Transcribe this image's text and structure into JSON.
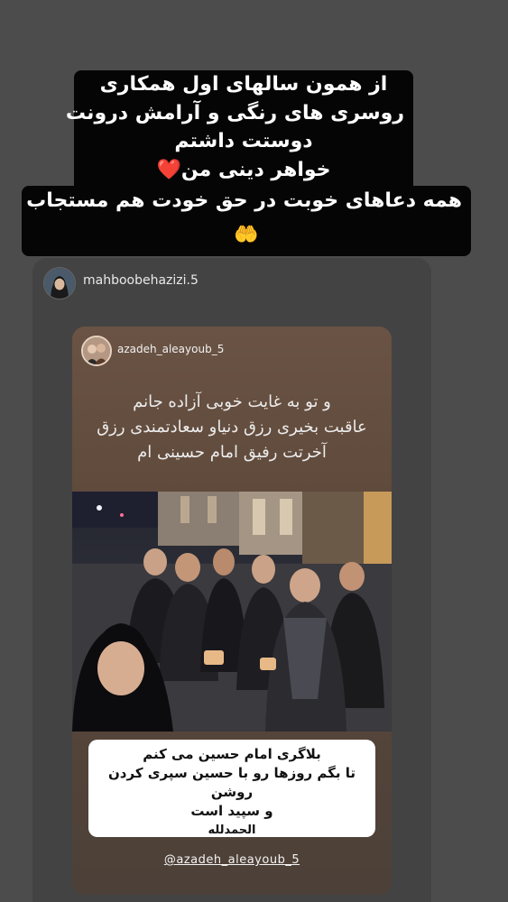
{
  "caption": {
    "lines": [
      "از همون سالهای اول همکاری",
      "روسری های رنگی و آرامش درونت",
      "دوستت داشتم",
      "خواهر دینی من❤️",
      "همه دعاهای خوبت در حق خودت هم مستجاب",
      "🤲"
    ]
  },
  "repost": {
    "username": "mahboobehazizi.5",
    "inner": {
      "username": "azadeh_aleayoub_5",
      "text_lines": [
        "و تو به غایت خوبی آزاده جانم",
        "عاقبت بخیری رزق دنیاو سعادتمندی رزق",
        "آخرتت رفیق امام حسینی ام"
      ],
      "sticker_lines": [
        "بلاگری امام حسین می کنم",
        "تا بگم روزها رو با حسین سپری کردن روشن",
        "و سپید است",
        "الحمدلله"
      ],
      "mention": "@azadeh_aleayoub_5"
    }
  },
  "colors": {
    "background": "#4c4c4d",
    "card": "#434343",
    "caption_box": "#050505",
    "inner_story": "#5f4a3c"
  }
}
